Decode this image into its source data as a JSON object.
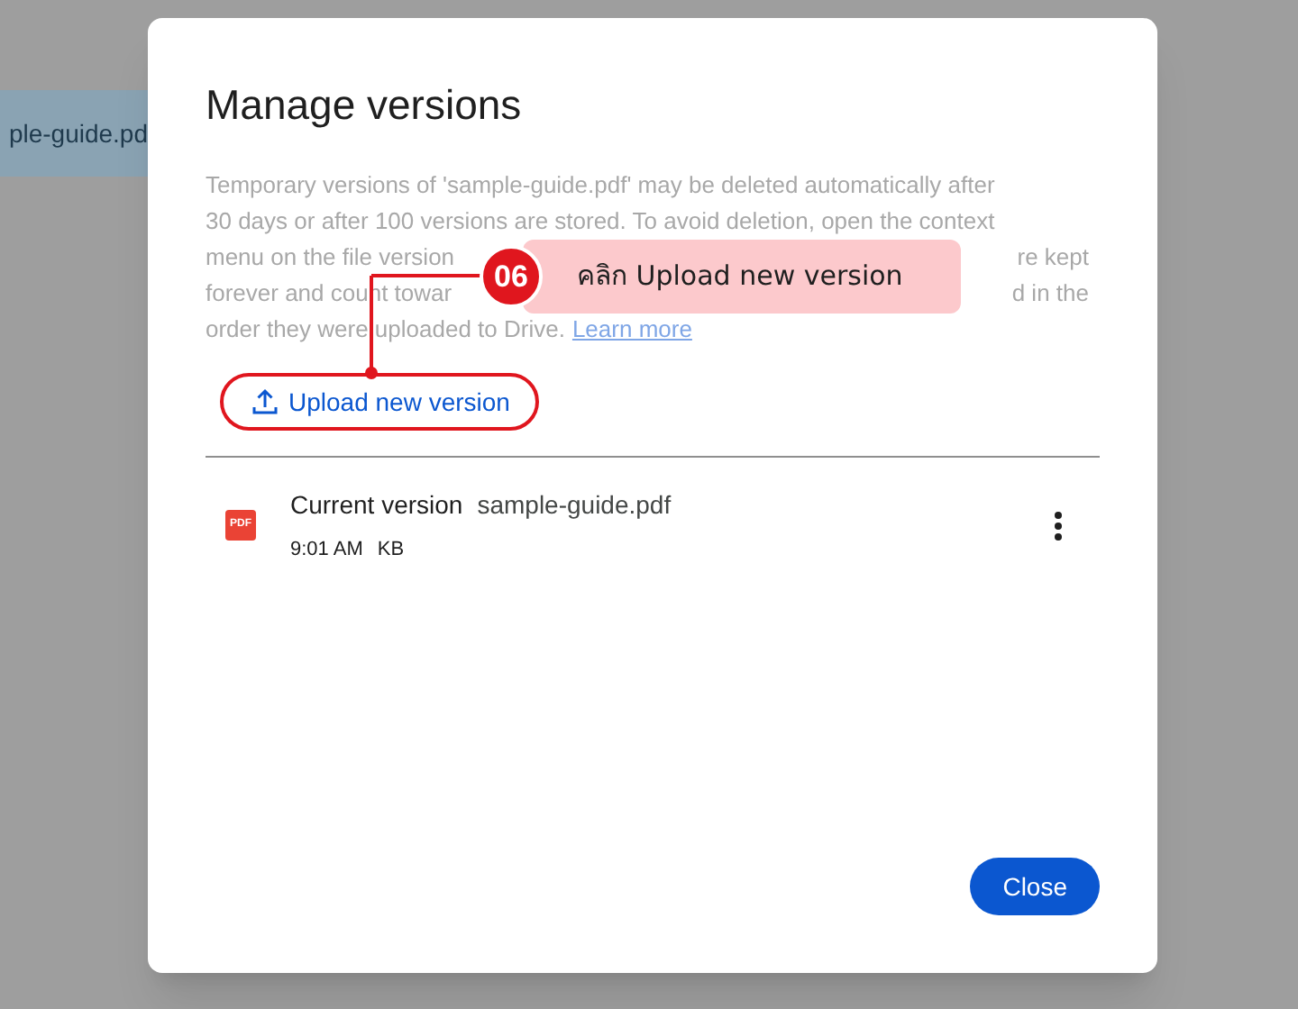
{
  "background": {
    "file_name": "ple-guide.pd"
  },
  "dialog": {
    "title": "Manage versions",
    "description_lines": [
      {
        "segments": [
          "Temporary versions of 'sample-guide.pdf' may be deleted automatically after"
        ]
      },
      {
        "segments": [
          "30 days or after 100 versions are stored. To avoid deletion, open the context"
        ]
      },
      {
        "segments": [
          "menu on the file version",
          "re kept"
        ]
      },
      {
        "segments": [
          "forever and count towar",
          "d in the"
        ]
      },
      {
        "segments": [
          "order they were uploaded to Drive."
        ],
        "link": "Learn more"
      }
    ],
    "upload_button": "Upload new version",
    "versions": [
      {
        "icon_label": "PDF",
        "label": "Current version",
        "file_name": "sample-guide.pdf",
        "time": "9:01 AM",
        "size": "KB"
      }
    ],
    "close_button": "Close"
  },
  "callout": {
    "step": "06",
    "text": "คลิก Upload new version"
  }
}
